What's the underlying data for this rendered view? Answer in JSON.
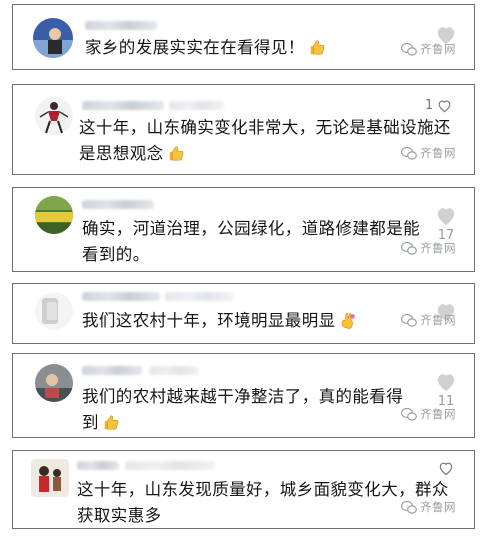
{
  "watermark": "齐鲁网",
  "comments": [
    {
      "text": "家乡的发展实实在在看得见！",
      "emoji": "thumbs-up-emoji",
      "likes": ""
    },
    {
      "text_line1": "这十年，山东确实变化非常大，无论是基础设施还",
      "text_line2": "是思想观念",
      "emoji": "thumbs-up-emoji",
      "likes": "1"
    },
    {
      "text_line1": "确实，河道治理，公园绿化，道路修建都是能",
      "text_line2": "看到的。",
      "likes": "17"
    },
    {
      "text": "我们这农村十年，环境明显最明显",
      "emoji": "crossed-fingers-emoji",
      "likes": ""
    },
    {
      "text_line1": "我们的农村越来越干净整洁了，真的能看得",
      "text_line2": "到",
      "emoji": "thumbs-up-emoji",
      "likes": "11"
    },
    {
      "text_line1": "这十年，山东发现质量好，城乡面貌变化大，群众",
      "text_line2": "获取实惠多",
      "likes": ""
    }
  ],
  "colors": {
    "border": "#6f6f6f",
    "like_icon": "#c7c7c7",
    "watermark": "#9aa0a6"
  }
}
